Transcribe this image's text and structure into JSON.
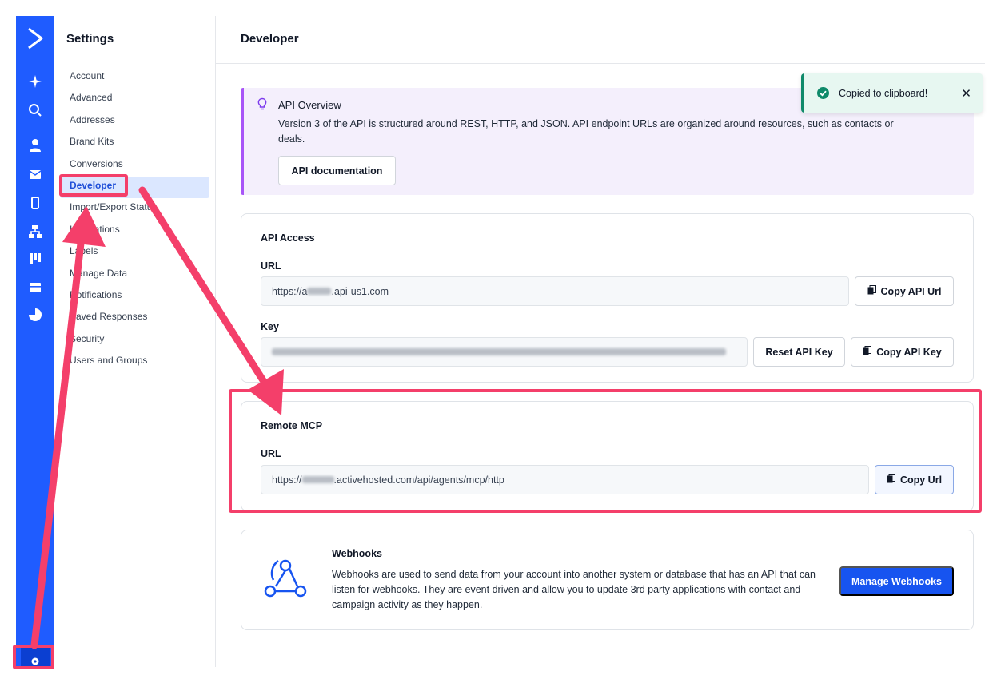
{
  "rail": {
    "logo": "activecampaign-chevron-logo",
    "icons": [
      "sparkle-icon",
      "search-icon",
      "contacts-icon",
      "mail-icon",
      "mobile-icon",
      "automation-icon",
      "pipeline-icon",
      "forms-icon",
      "reports-icon"
    ],
    "settings_icon": "gear-icon"
  },
  "sidebar": {
    "title": "Settings",
    "items": [
      {
        "label": "Account"
      },
      {
        "label": "Advanced"
      },
      {
        "label": "Addresses"
      },
      {
        "label": "Brand Kits"
      },
      {
        "label": "Conversions"
      },
      {
        "label": "Developer"
      },
      {
        "label": "Import/Export Status"
      },
      {
        "label": "Integrations"
      },
      {
        "label": "Labels"
      },
      {
        "label": "Manage Data"
      },
      {
        "label": "Notifications"
      },
      {
        "label": "Saved Responses"
      },
      {
        "label": "Security"
      },
      {
        "label": "Users and Groups"
      }
    ],
    "active": "Developer"
  },
  "main": {
    "title": "Developer",
    "overview": {
      "title": "API Overview",
      "text": "Version 3 of the API is structured around REST, HTTP, and JSON. API endpoint URLs are organized around resources, such as contacts or deals.",
      "button": "API documentation"
    },
    "api_access": {
      "title": "API Access",
      "url_label": "URL",
      "url_prefix": "https://a",
      "url_suffix": ".api-us1.com",
      "copy_url_button": "Copy API Url",
      "key_label": "Key",
      "reset_button": "Reset API Key",
      "copy_key_button": "Copy API Key"
    },
    "remote_mcp": {
      "title": "Remote MCP",
      "url_label": "URL",
      "url_prefix": "https://",
      "url_suffix": ".activehosted.com/api/agents/mcp/http",
      "copy_button": "Copy Url"
    },
    "webhooks": {
      "title": "Webhooks",
      "text": "Webhooks are used to send data from your account into another system or database that has an API that can listen for webhooks. They are event driven and allow you to update 3rd party applications with contact and campaign activity as they happen.",
      "button": "Manage Webhooks"
    }
  },
  "toast": {
    "text": "Copied to clipboard!",
    "close": "✕"
  },
  "colors": {
    "rail": "#1f5cff",
    "primary": "#1754f0",
    "active_bg": "#dbe7ff",
    "overview_bg": "#f4effc",
    "overview_accent": "#a855f7",
    "toast_accent": "#0f8a6a",
    "annotation": "#f43f6a"
  }
}
